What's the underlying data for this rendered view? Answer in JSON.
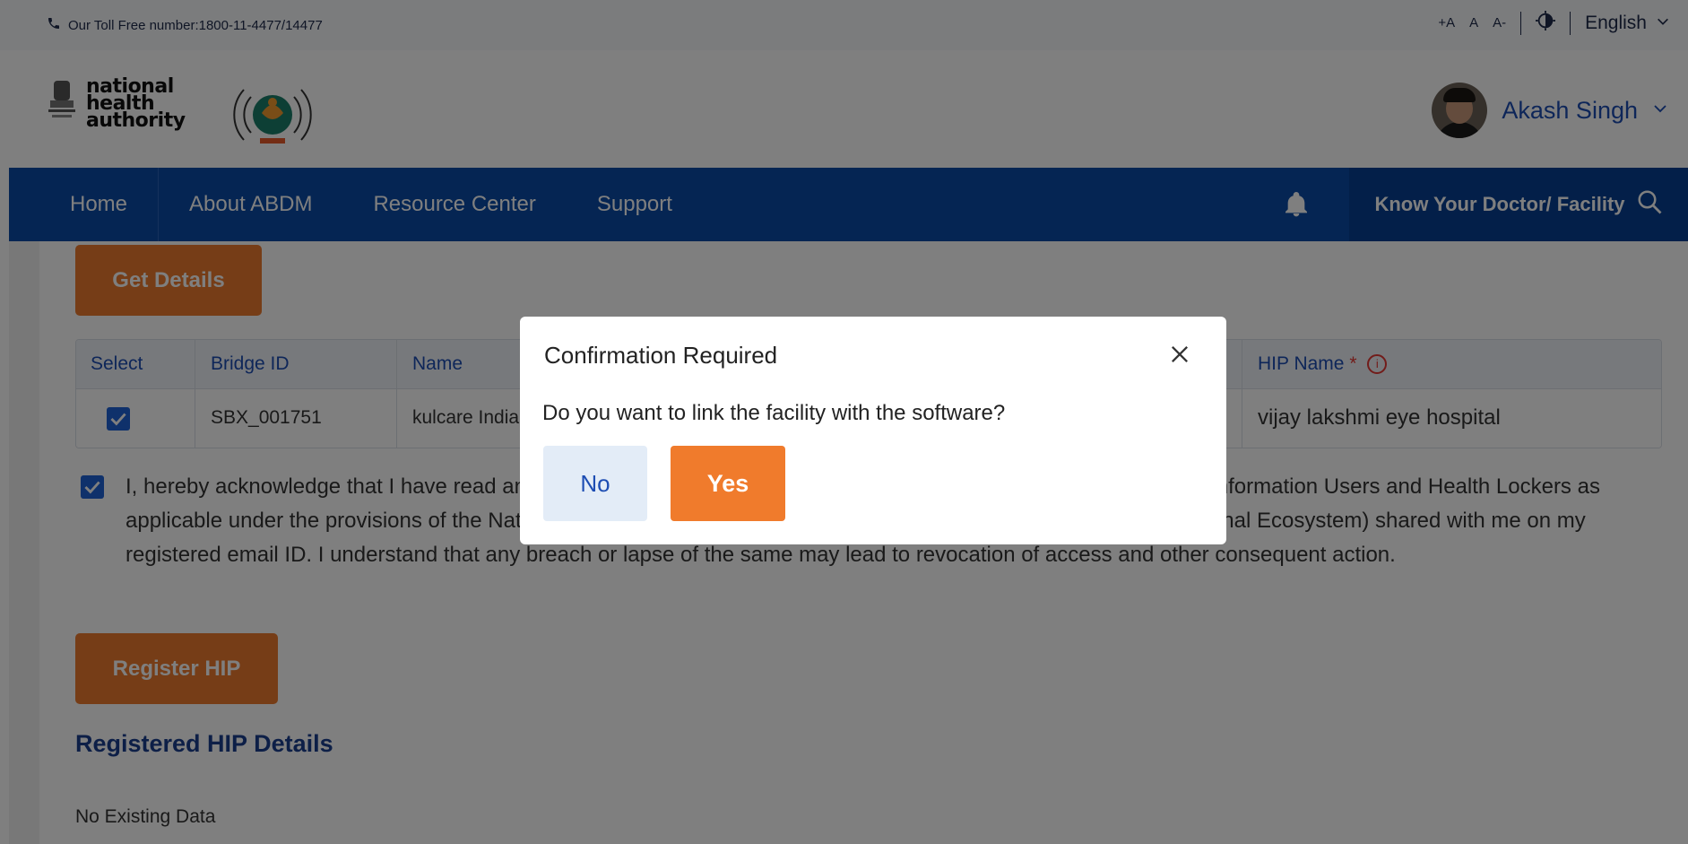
{
  "topbar": {
    "toll_text": "Our Toll Free number:1800-11-4477/14477",
    "font_increase": "+A",
    "font_normal": "A",
    "font_decrease": "A-",
    "language": "English"
  },
  "header": {
    "nha_line1": "national",
    "nha_line2": "health",
    "nha_line3": "authority",
    "user_name": "Akash Singh"
  },
  "nav": {
    "items": [
      "Home",
      "About ABDM",
      "Resource Center",
      "Support"
    ],
    "know_your_doctor": "Know Your Doctor/ Facility"
  },
  "main": {
    "get_details_label": "Get Details",
    "table": {
      "headers": [
        "Select",
        "Bridge ID",
        "Name",
        "HIP Name"
      ],
      "required_marker": "*",
      "info_marker": "i",
      "row": {
        "bridge_id": "SBX_001751",
        "name": "kulcare India",
        "hip_name": "vijay lakshmi eye hospital"
      }
    },
    "acknowledgement": "I, hereby acknowledge that I have read and understood the obligations of the Health Repository Providers, Health Information Users and Health Lockers as applicable under the provisions of the National Digital Health Mission Information Security Policy 2020 (Part 2-External Ecosystem) shared with me on my registered email ID. I understand that any breach or lapse of the same may lead to revocation of access and other consequent action.",
    "register_hip_label": "Register HIP",
    "registered_title": "Registered HIP Details",
    "no_data": "No Existing Data"
  },
  "modal": {
    "title": "Confirmation Required",
    "message": "Do you want to link the facility with the software?",
    "no_label": "No",
    "yes_label": "Yes"
  },
  "colors": {
    "nav_blue": "#0a4aa6",
    "accent_orange": "#ec7b2f",
    "link_blue": "#1d4db3",
    "overlay": "rgba(0,0,0,0.5)"
  },
  "icons": {
    "phone": "phone-icon",
    "contrast": "contrast-icon",
    "chevron": "chevron-down-icon",
    "bell": "bell-icon",
    "search": "search-icon",
    "close": "close-icon",
    "check": "check-icon"
  }
}
